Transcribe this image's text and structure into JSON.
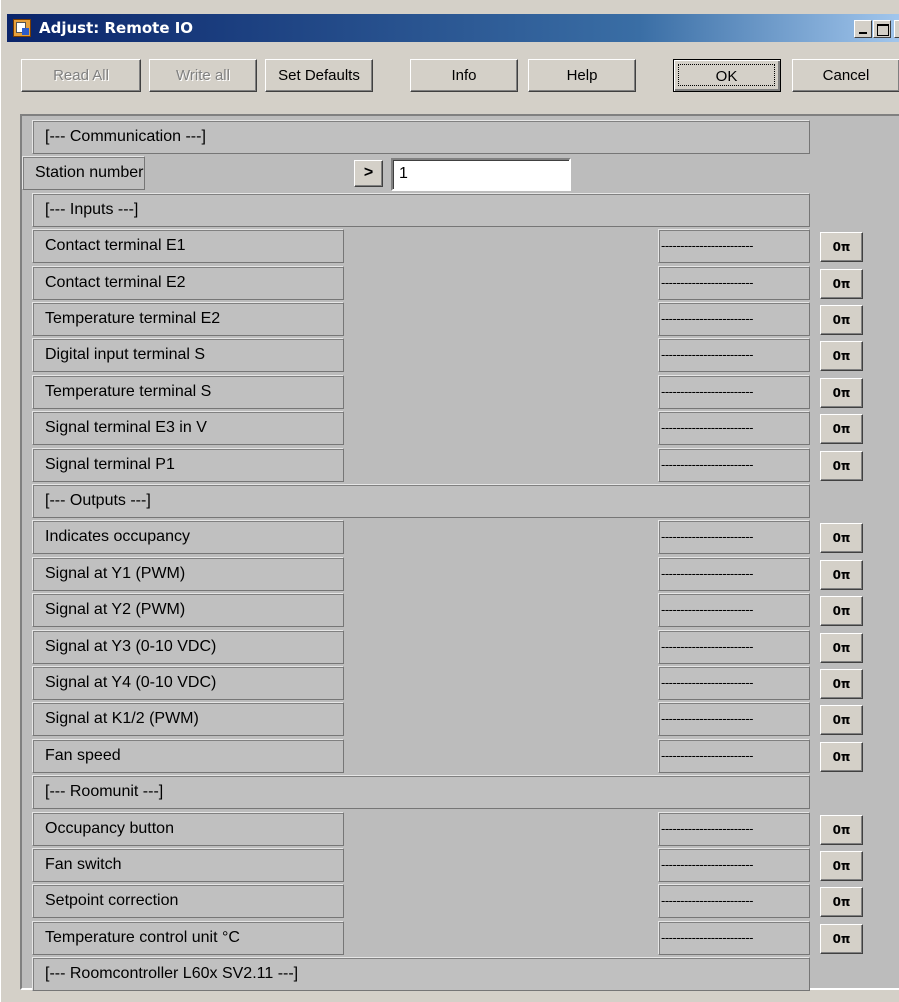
{
  "window": {
    "title": "Adjust: Remote IO"
  },
  "toolbar": {
    "read_all": "Read All",
    "write_all": "Write all",
    "set_defaults": "Set Defaults",
    "info": "Info",
    "help": "Help",
    "ok": "OK",
    "cancel": "Cancel"
  },
  "icons": {
    "key": "key-icon",
    "arrow": "arrow-right-icon"
  },
  "colors": {
    "titlebar_start": "#0a246a",
    "titlebar_end": "#a6caf0",
    "panel": "#bcbcbc"
  },
  "rows": [
    {
      "type": "section",
      "label": "[--- Communication ---]"
    },
    {
      "type": "station",
      "label": "Station number",
      "arrow": ">",
      "value": "1"
    },
    {
      "type": "section",
      "label": "[--- Inputs ---]"
    },
    {
      "type": "param",
      "label": "Contact terminal E1",
      "value": "------------------------",
      "key": "0π"
    },
    {
      "type": "param",
      "label": "Contact terminal E2",
      "value": "------------------------",
      "key": "0π"
    },
    {
      "type": "param",
      "label": "Temperature terminal E2",
      "value": "------------------------",
      "key": "0π"
    },
    {
      "type": "param",
      "label": "Digital input terminal S",
      "value": "------------------------",
      "key": "0π"
    },
    {
      "type": "param",
      "label": "Temperature terminal S",
      "value": "------------------------",
      "key": "0π"
    },
    {
      "type": "param",
      "label": "Signal terminal E3 in V",
      "value": "------------------------",
      "key": "0π"
    },
    {
      "type": "param",
      "label": "Signal terminal P1",
      "value": "------------------------",
      "key": "0π"
    },
    {
      "type": "section",
      "label": "[--- Outputs ---]"
    },
    {
      "type": "param",
      "label": "Indicates occupancy",
      "value": "------------------------",
      "key": "0π"
    },
    {
      "type": "param",
      "label": "Signal at Y1 (PWM)",
      "value": "------------------------",
      "key": "0π"
    },
    {
      "type": "param",
      "label": "Signal at Y2 (PWM)",
      "value": "------------------------",
      "key": "0π"
    },
    {
      "type": "param",
      "label": "Signal at Y3 (0-10 VDC)",
      "value": "------------------------",
      "key": "0π"
    },
    {
      "type": "param",
      "label": "Signal at Y4 (0-10 VDC)",
      "value": "------------------------",
      "key": "0π"
    },
    {
      "type": "param",
      "label": "Signal at K1/2 (PWM)",
      "value": "------------------------",
      "key": "0π"
    },
    {
      "type": "param",
      "label": "Fan speed",
      "value": "------------------------",
      "key": "0π"
    },
    {
      "type": "section",
      "label": "[--- Roomunit ---]"
    },
    {
      "type": "param",
      "label": "Occupancy button",
      "value": "------------------------",
      "key": "0π"
    },
    {
      "type": "param",
      "label": "Fan switch",
      "value": "------------------------",
      "key": "0π"
    },
    {
      "type": "param",
      "label": "Setpoint correction",
      "value": "------------------------",
      "key": "0π"
    },
    {
      "type": "param",
      "label": "Temperature control unit °C",
      "value": "------------------------",
      "key": "0π"
    },
    {
      "type": "section",
      "label": "[--- Roomcontroller L60x SV2.11 ---]"
    }
  ]
}
